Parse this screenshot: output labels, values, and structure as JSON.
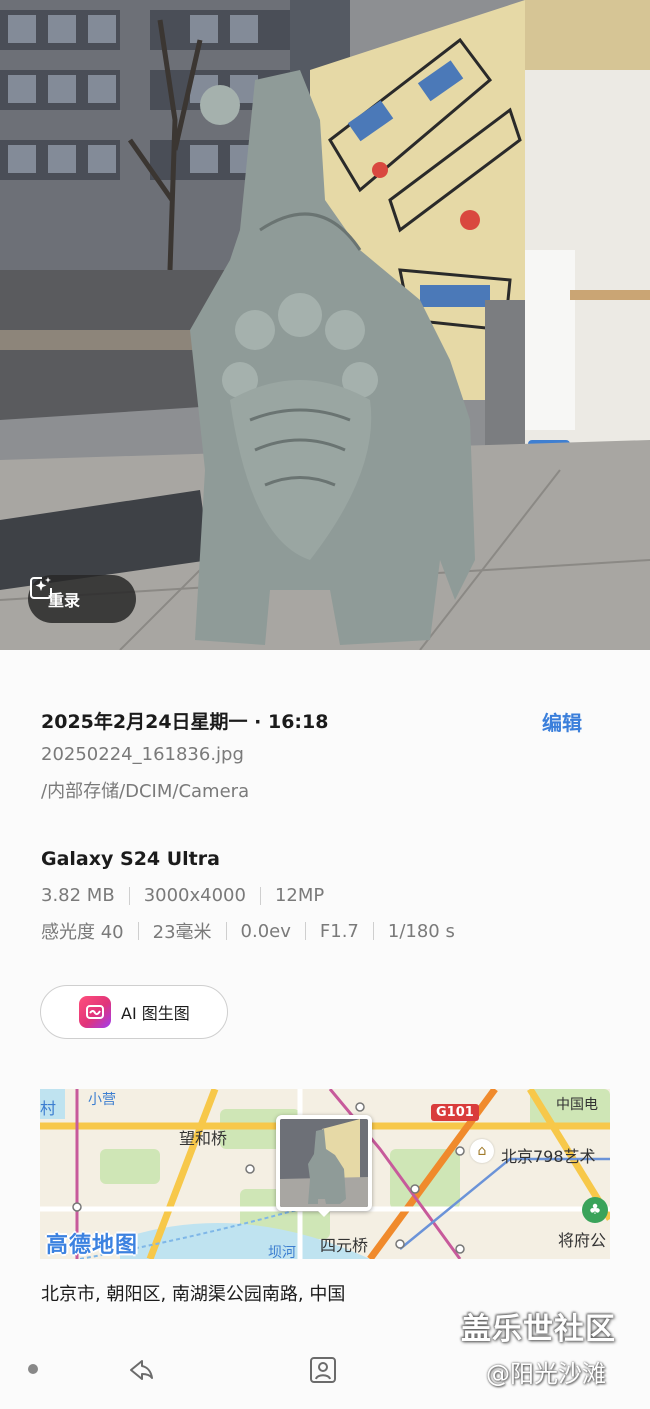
{
  "photo": {
    "remaster_label": "重录",
    "icon": "sparkle-frame-icon"
  },
  "details": {
    "date_time": "2025年2月24日星期一 · 16:18",
    "edit_label": "编辑",
    "file_name": "20250224_161836.jpg",
    "file_path": "/内部存储/DCIM/Camera"
  },
  "camera": {
    "device": "Galaxy S24 Ultra",
    "row1": [
      "3.82 MB",
      "3000x4000",
      "12MP"
    ],
    "row2": [
      "感光度 40",
      "23毫米",
      "0.0ev",
      "F1.7",
      "1/180 s"
    ]
  },
  "ai_button": {
    "label": "AI 图生图",
    "icon": "ai-image-app-icon",
    "icon_colors": [
      "#ff4f7b",
      "#a13cf0"
    ]
  },
  "map": {
    "brand": "高德地图",
    "labels": {
      "wanghe_bridge": "望和桥",
      "siyuan_bridge": "四元桥",
      "art_district": "北京798艺术",
      "zhongguodian": "中国电",
      "jiangfu": "将府公",
      "road": "G101",
      "top_left": "村",
      "top_left2": "小营",
      "river": "坝河"
    },
    "road_color": "#d93c3c"
  },
  "location": {
    "address": "北京市, 朝阳区, 南湖渠公园南路, 中国"
  },
  "watermark": {
    "title": "盖乐世社区",
    "author": "@阳光沙滩"
  },
  "navbar": {
    "icons": [
      "dot-icon",
      "share-icon",
      "profile-icon"
    ]
  }
}
